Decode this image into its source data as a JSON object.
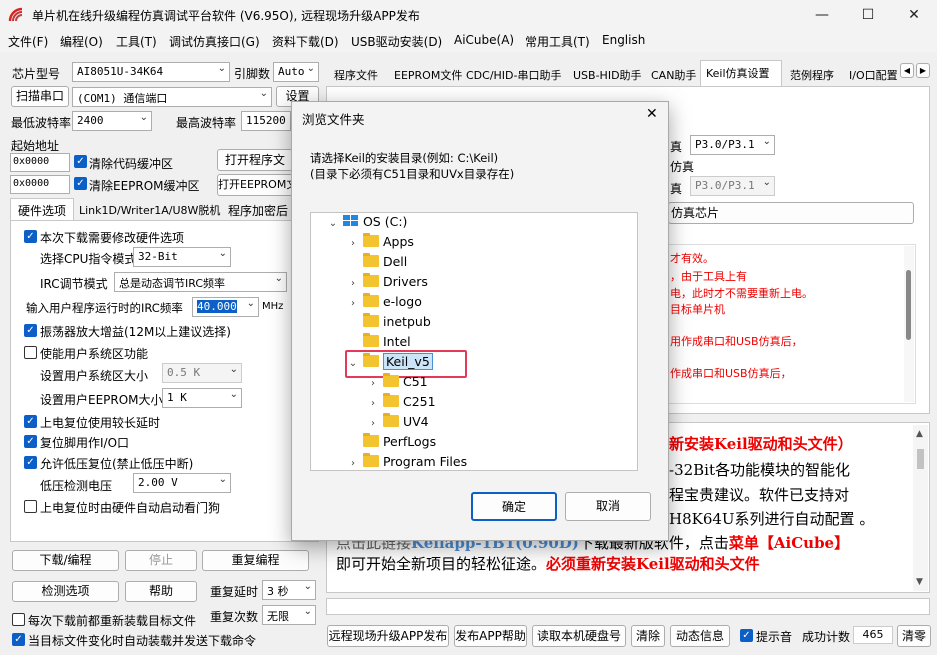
{
  "window": {
    "title": "单片机在线升级编程仿真调试平台软件 (V6.95O), 远程现场升级APP发布",
    "min": "—",
    "max": "☐",
    "close": "✕"
  },
  "menu": [
    "文件(F)",
    "编程(O)",
    "工具(T)",
    "调试仿真接口(G)",
    "资料下载(D)",
    "USB驱动安装(D)",
    "AiCube(A)",
    "常用工具(T)",
    "English"
  ],
  "left": {
    "chip_label": "芯片型号",
    "chip_value": "AI8051U-34K64",
    "pins_label": "引脚数",
    "pins_value": "Auto",
    "scan_btn": "扫描串口",
    "port_value": "(COM1) 通信端口",
    "settings_btn": "设置",
    "min_baud_label": "最低波特率",
    "min_baud": "2400",
    "max_baud_label": "最高波特率",
    "max_baud": "115200",
    "start_addr_label": "起始地址",
    "addr1": "0x0000",
    "clear_code": "清除代码缓冲区",
    "open_prog": "打开程序文",
    "addr2": "0x0000",
    "clear_eeprom": "清除EEPROM缓冲区",
    "open_eeprom": "打开EEPROM文",
    "subtabs": [
      "硬件选项",
      "Link1D/Writer1A/U8W脱机",
      "程序加密后"
    ],
    "opt_modify": "本次下载需要修改硬件选项",
    "cpu_mode_label": "选择CPU指令模式",
    "cpu_mode": "32-Bit",
    "irc_label": "IRC调节模式",
    "irc_value": "总是动态调节IRC频率",
    "freq_label": "输入用户程序运行时的IRC频率",
    "freq_value": "40.000",
    "freq_unit": "MHz",
    "osc_gain": "振荡器放大增益(12M以上建议选择)",
    "user_sys": "使能用户系统区功能",
    "sys_size_label": "设置用户系统区大小",
    "sys_size": "0.5 K",
    "eeprom_size_label": "设置用户EEPROM大小",
    "eeprom_size": "1    K",
    "long_delay": "上电复位使用较长延时",
    "reset_io": "复位脚用作I/O口",
    "lvr": "允许低压复位(禁止低压中断)",
    "lv_label": "低压检测电压",
    "lv_value": "2.00 V",
    "wdt": "上电复位时由硬件自动启动看门狗",
    "download_btn": "下载/编程",
    "stop_btn": "停止",
    "reprog_btn": "重复编程",
    "detect_btn": "检测选项",
    "help_btn": "帮助",
    "repeat_delay_label": "重复延时",
    "repeat_delay": "3 秒",
    "reload_each": "每次下载前都重新装载目标文件",
    "repeat_count_label": "重复次数",
    "repeat_count": "无限",
    "auto_reload": "当目标文件变化时自动装载并发送下载命令"
  },
  "right": {
    "tabs": [
      "程序文件",
      "EEPROM文件",
      "CDC/HID-串口助手",
      "USB-HID助手",
      "CAN助手",
      "Keil仿真设置",
      "范例程序",
      "I/O口配置"
    ],
    "scroll_left": "◀",
    "scroll_right": "▶",
    "emu1_label": "真",
    "emu1_value": "P3.0/P3.1",
    "emu2_label": "仿真",
    "emu3_label": "真",
    "emu3_value": "P3.0/P3.1",
    "chip_emu_btn": "仿真芯片",
    "notes": [
      "才有效。",
      "，由于工具上有",
      "电，此时才不需要重新上电。",
      "目标单片机",
      "用作成串口和USB仿真后，",
      "作成串口和USB仿真后，"
    ],
    "info_head": "新安装Keil驱动和头文件）",
    "info_l2": "-32Bit各功能模块的智能化",
    "info_l3": "程宝贵建议。软件已支持对",
    "info_l4": "H8K64U系列进行自动配置 。",
    "info_l5a": "点击此链接",
    "info_l5link": "Keilapp-1B1(0.90D)",
    "info_l5b": "下载最新版软件，点击",
    "info_l5c": "菜单【AiCube】",
    "info_l6a": "即可开始全新项目的轻松征途。",
    "info_l6b": "必须重新安装Keil驱动和头文件"
  },
  "bottom": {
    "remote": "远程现场升级APP发布",
    "publish_help": "发布APP帮助",
    "read_disk": "读取本机硬盘号",
    "clear": "清除",
    "dyn_info": "动态信息",
    "beep": "提示音",
    "success_label": "成功计数",
    "success_count": "465",
    "clear2": "清零"
  },
  "dialog": {
    "title": "浏览文件夹",
    "close": "✕",
    "prompt1": "请选择Keil的安装目录(例如: C:\\Keil)",
    "prompt2": "(目录下必须有C51目录和UVx目录存在)",
    "tree": [
      "OS (C:)",
      "Apps",
      "Dell",
      "Drivers",
      "e-logo",
      "inetpub",
      "Intel",
      "Keil_v5",
      "C51",
      "C251",
      "UV4",
      "PerfLogs",
      "Program Files"
    ],
    "ok": "确定",
    "cancel": "取消"
  }
}
